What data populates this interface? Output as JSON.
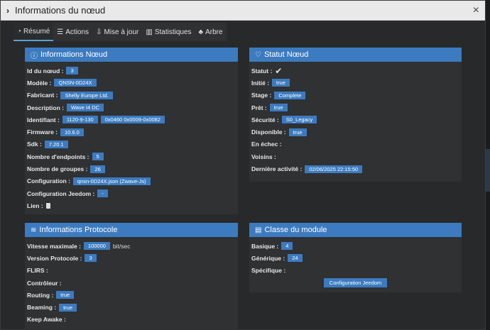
{
  "modal": {
    "title": "Informations du nœud"
  },
  "tabs": [
    {
      "icon": "gauge",
      "label": "Résumé"
    },
    {
      "icon": "list",
      "label": "Actions"
    },
    {
      "icon": "download",
      "label": "Mise à jour"
    },
    {
      "icon": "chart",
      "label": "Statistiques"
    },
    {
      "icon": "tree",
      "label": "Arbre"
    }
  ],
  "node_info": {
    "title": "Informations Nœud",
    "rows": [
      {
        "label": "Id du nœud :",
        "values": [
          "3"
        ]
      },
      {
        "label": "Modèle :",
        "values": [
          "QNSN-0D24X"
        ]
      },
      {
        "label": "Fabricant :",
        "values": [
          "Shelly Europe Ltd."
        ]
      },
      {
        "label": "Description :",
        "values": [
          "Wave I4 DC"
        ]
      },
      {
        "label": "Identifiant :",
        "values": [
          "1120-9-130",
          "0x0460 0x0009-0x0082"
        ]
      },
      {
        "label": "Firmware :",
        "values": [
          "10.6.0"
        ]
      },
      {
        "label": "Sdk :",
        "values": [
          "7.20.1"
        ]
      },
      {
        "label": "Nombre d'endpoints :",
        "values": [
          "5"
        ]
      },
      {
        "label": "Nombre de groupes :",
        "values": [
          "26"
        ]
      },
      {
        "label": "Configuration :",
        "values": [
          "qnsn-0D24X.json (Zwave-Js)"
        ]
      },
      {
        "label": "Configuration Jeedom :",
        "values": [
          "-"
        ]
      },
      {
        "label": "Lien :",
        "values": []
      }
    ]
  },
  "node_status": {
    "title": "Statut Nœud",
    "rows": [
      {
        "label": "Statut :",
        "values": []
      },
      {
        "label": "Initié :",
        "values": [
          "true"
        ]
      },
      {
        "label": "Stage :",
        "values": [
          "Complete"
        ]
      },
      {
        "label": "Prêt :",
        "values": [
          "true"
        ]
      },
      {
        "label": "Sécurité :",
        "values": [
          "S0_Legacy"
        ]
      },
      {
        "label": "Disponible :",
        "values": [
          "true"
        ]
      },
      {
        "label": "En échec :",
        "values": []
      },
      {
        "label": "Voisins :",
        "values": []
      },
      {
        "label": "Dernière activité :",
        "values": [
          "02/06/2025 22:15:50"
        ]
      }
    ]
  },
  "protocol_info": {
    "title": "Informations Protocole",
    "rows": [
      {
        "label": "Vitesse maximale :",
        "values": [
          "100000"
        ],
        "unit": "bit/sec"
      },
      {
        "label": "Version Protocole :",
        "values": [
          "3"
        ]
      },
      {
        "label": "FLIRS :",
        "values": []
      },
      {
        "label": "Contrôleur :",
        "values": []
      },
      {
        "label": "Routing :",
        "values": [
          "true"
        ]
      },
      {
        "label": "Beaming :",
        "values": [
          "true"
        ]
      },
      {
        "label": "Keep Awake :",
        "values": []
      }
    ]
  },
  "module_class": {
    "title": "Classe du module",
    "rows": [
      {
        "label": "Basique :",
        "values": [
          "4"
        ]
      },
      {
        "label": "Générique :",
        "values": [
          "24"
        ]
      },
      {
        "label": "Spécifique :",
        "values": []
      }
    ],
    "button_label": "Configuration Jeedom"
  }
}
